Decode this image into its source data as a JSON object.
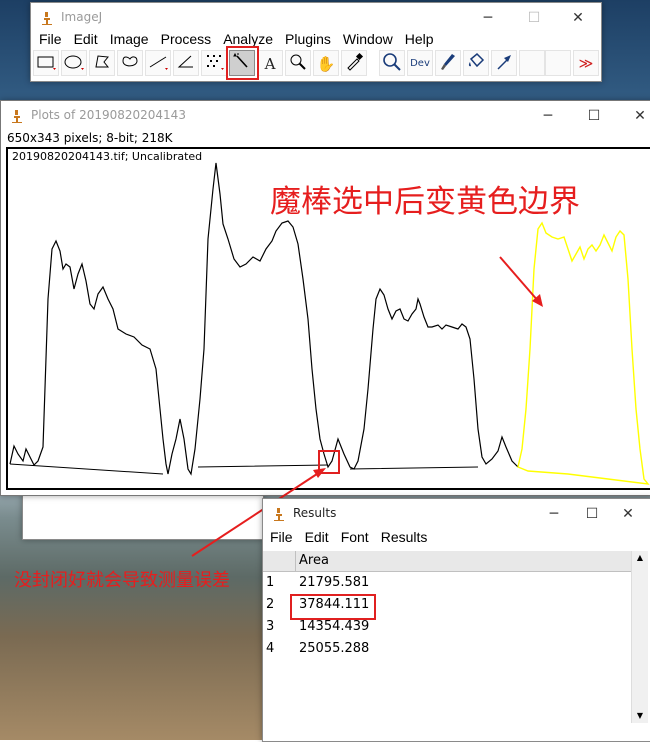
{
  "imagej": {
    "title": "ImageJ",
    "menu": [
      "File",
      "Edit",
      "Image",
      "Process",
      "Analyze",
      "Plugins",
      "Window",
      "Help"
    ],
    "dev_label": "Dev",
    "more_label": "≫"
  },
  "plot_window": {
    "title": "Plots of 20190820204143",
    "info": "650x343 pixels; 8-bit; 218K",
    "image_label": "20190820204143.tif; Uncalibrated"
  },
  "results": {
    "title": "Results",
    "menu": [
      "File",
      "Edit",
      "Font",
      "Results"
    ],
    "column_header": "Area",
    "rows": [
      {
        "index": "1",
        "area": "21795.581"
      },
      {
        "index": "2",
        "area": "37844.111"
      },
      {
        "index": "3",
        "area": "14354.439"
      },
      {
        "index": "4",
        "area": "25055.288"
      }
    ]
  },
  "annotations": {
    "yellow_border_note": "魔棒选中后变黄色边界",
    "gap_note": "没封闭好就会导致测量误差"
  },
  "colors": {
    "annotation_red": "#e61e1e",
    "selection_yellow": "#ffff00",
    "plot_line": "#000000"
  }
}
